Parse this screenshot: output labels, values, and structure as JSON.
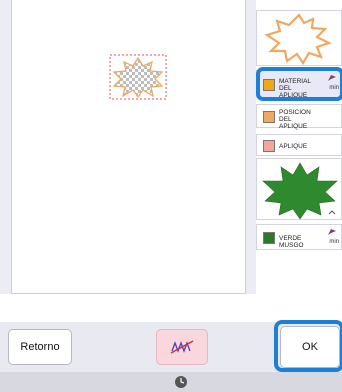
{
  "threads": [
    {
      "label": "MATERIAL DEL APLIQUE",
      "info": "min",
      "color": "#f0a818",
      "selected": true
    },
    {
      "label": "POSICION DEL APLIQUE",
      "info": "",
      "color": "#f0a860"
    },
    {
      "label": "APLIQUE",
      "info": "",
      "color": "#f4a49a"
    },
    {
      "label": "VERDE MUSGO",
      "info": "min",
      "color": "#2a7a2a"
    }
  ],
  "bottom": {
    "back_label": "Retorno",
    "ok_label": "OK"
  },
  "colors": {
    "accent": "#1e7fd6",
    "leaf_green": "#2f8a2f",
    "outline_orange": "#f0a860"
  },
  "icons": [
    "appliqué-preview-icon",
    "no-stitch-icon",
    "clock-icon"
  ]
}
